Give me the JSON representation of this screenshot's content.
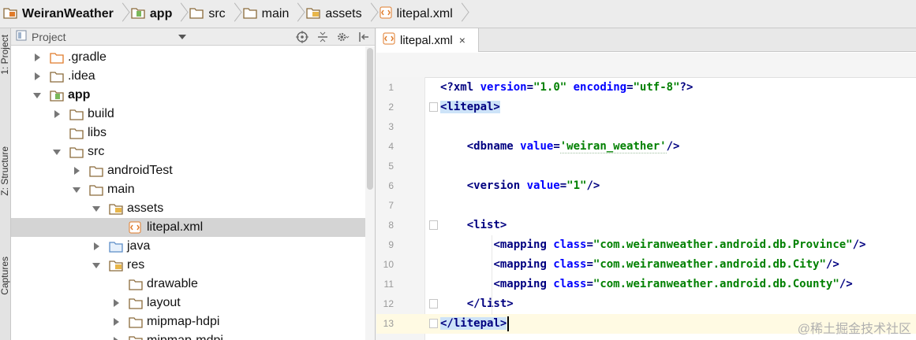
{
  "breadcrumbs": [
    {
      "label": "WeiranWeather",
      "icon": "project-icon",
      "bold": true
    },
    {
      "label": "app",
      "icon": "module-folder-icon",
      "bold": true
    },
    {
      "label": "src",
      "icon": "folder-icon",
      "bold": false
    },
    {
      "label": "main",
      "icon": "folder-icon",
      "bold": false
    },
    {
      "label": "assets",
      "icon": "assets-folder-icon",
      "bold": false
    },
    {
      "label": "litepal.xml",
      "icon": "xml-file-icon",
      "bold": false
    }
  ],
  "left_strip": {
    "tabs": [
      "1: Project",
      "Z: Structure",
      "Captures"
    ]
  },
  "project_panel": {
    "title": "Project",
    "tree": [
      {
        "label": ".gradle",
        "level": 1,
        "arrow": "right",
        "icon": "folder-orange-icon"
      },
      {
        "label": ".idea",
        "level": 1,
        "arrow": "right",
        "icon": "folder-icon"
      },
      {
        "label": "app",
        "level": 1,
        "arrow": "down",
        "icon": "module-folder-icon",
        "bold": true
      },
      {
        "label": "build",
        "level": 2,
        "arrow": "right",
        "icon": "folder-icon"
      },
      {
        "label": "libs",
        "level": 2,
        "arrow": "none",
        "icon": "folder-icon"
      },
      {
        "label": "src",
        "level": 2,
        "arrow": "down",
        "icon": "folder-icon"
      },
      {
        "label": "androidTest",
        "level": 3,
        "arrow": "right",
        "icon": "folder-icon"
      },
      {
        "label": "main",
        "level": 3,
        "arrow": "down",
        "icon": "folder-icon"
      },
      {
        "label": "assets",
        "level": 4,
        "arrow": "down",
        "icon": "assets-folder-icon"
      },
      {
        "label": "litepal.xml",
        "level": 5,
        "arrow": "none",
        "icon": "xml-file-icon",
        "selected": true
      },
      {
        "label": "java",
        "level": 4,
        "arrow": "right",
        "icon": "java-folder-icon"
      },
      {
        "label": "res",
        "level": 4,
        "arrow": "down",
        "icon": "res-folder-icon"
      },
      {
        "label": "drawable",
        "level": 5,
        "arrow": "none",
        "icon": "folder-icon"
      },
      {
        "label": "layout",
        "level": 5,
        "arrow": "right",
        "icon": "folder-icon"
      },
      {
        "label": "mipmap-hdpi",
        "level": 5,
        "arrow": "right",
        "icon": "folder-icon"
      },
      {
        "label": "mipmap-mdpi",
        "level": 5,
        "arrow": "right",
        "icon": "folder-icon"
      }
    ]
  },
  "editor": {
    "tab_label": "litepal.xml",
    "tab_close": "×",
    "lines": [
      {
        "n": "1",
        "segs": [
          [
            "pi",
            "<?xml "
          ],
          [
            "attr",
            "version"
          ],
          [
            "pi",
            "="
          ],
          [
            "val",
            "\"1.0\""
          ],
          [
            "pi",
            " "
          ],
          [
            "attr",
            "encoding"
          ],
          [
            "pi",
            "="
          ],
          [
            "val",
            "\"utf-8\""
          ],
          [
            "pi",
            "?>"
          ]
        ]
      },
      {
        "n": "2",
        "fold": true,
        "segs": [
          [
            "hl",
            "<litepal>"
          ]
        ]
      },
      {
        "n": "3",
        "segs": []
      },
      {
        "n": "4",
        "segs": [
          [
            "sp",
            "    "
          ],
          [
            "tag",
            "<dbname "
          ],
          [
            "attr",
            "value"
          ],
          [
            "tag",
            "="
          ],
          [
            "valu",
            "'weiran_weather'"
          ],
          [
            "tag",
            "/>"
          ]
        ]
      },
      {
        "n": "5",
        "segs": []
      },
      {
        "n": "6",
        "segs": [
          [
            "sp",
            "    "
          ],
          [
            "tag",
            "<version "
          ],
          [
            "attr",
            "value"
          ],
          [
            "tag",
            "="
          ],
          [
            "val",
            "\"1\""
          ],
          [
            "tag",
            "/>"
          ]
        ]
      },
      {
        "n": "7",
        "segs": []
      },
      {
        "n": "8",
        "fold": true,
        "segs": [
          [
            "sp",
            "    "
          ],
          [
            "tag",
            "<list>"
          ]
        ]
      },
      {
        "n": "9",
        "segs": [
          [
            "sp",
            "        "
          ],
          [
            "tag",
            "<mapping "
          ],
          [
            "attr",
            "class"
          ],
          [
            "tag",
            "="
          ],
          [
            "val",
            "\"com.weiranweather.android.db.Province\""
          ],
          [
            "tag",
            "/>"
          ]
        ]
      },
      {
        "n": "10",
        "segs": [
          [
            "sp",
            "        "
          ],
          [
            "tag",
            "<mapping "
          ],
          [
            "attr",
            "class"
          ],
          [
            "tag",
            "="
          ],
          [
            "val",
            "\"com.weiranweather.android.db.City\""
          ],
          [
            "tag",
            "/>"
          ]
        ]
      },
      {
        "n": "11",
        "segs": [
          [
            "sp",
            "        "
          ],
          [
            "tag",
            "<mapping "
          ],
          [
            "attr",
            "class"
          ],
          [
            "tag",
            "="
          ],
          [
            "val",
            "\"com.weiranweather.android.db.County\""
          ],
          [
            "tag",
            "/>"
          ]
        ]
      },
      {
        "n": "12",
        "fold": true,
        "segs": [
          [
            "sp",
            "    "
          ],
          [
            "tag",
            "</list>"
          ]
        ]
      },
      {
        "n": "13",
        "fold": true,
        "current": true,
        "segs": [
          [
            "hl",
            "</litepal>"
          ],
          [
            "caret",
            ""
          ]
        ]
      }
    ]
  },
  "watermark": "@稀土掘金技术社区",
  "colors": {
    "tag": "#000080",
    "attribute": "#0000ff",
    "value": "#008000",
    "selection": "#cde3f8",
    "current_line": "#fffae3",
    "folder_orange": "#e07b2a"
  }
}
